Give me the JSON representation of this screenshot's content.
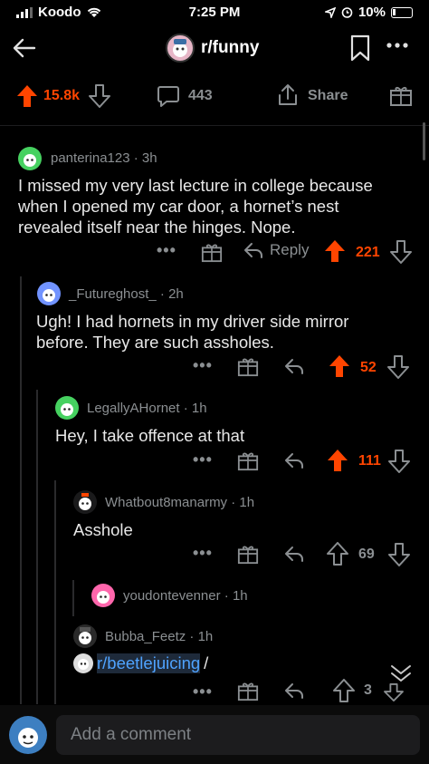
{
  "status_bar": {
    "carrier": "Koodo",
    "time": "7:25 PM",
    "battery": "10%"
  },
  "header": {
    "subreddit": "r/funny"
  },
  "post_actions": {
    "votes": "15.8k",
    "comments": "443",
    "share": "Share"
  },
  "comments": [
    {
      "author": "panterina123",
      "age": "3h",
      "text": "I missed my very last lecture in college because when I opened my car door, a hornet’s nest revealed itself near the hinges. Nope.",
      "reply_label": "Reply",
      "score": "221",
      "upvoted": true
    },
    {
      "author": "_Futureghost_",
      "age": "2h",
      "text": "Ugh! I had hornets in my driver side mirror before. They are such assholes.",
      "score": "52",
      "upvoted": true
    },
    {
      "author": "LegallyAHornet",
      "age": "1h",
      "text": "Hey, I take offence at that",
      "score": "111",
      "upvoted": true
    },
    {
      "author": "Whatbout8manarmy",
      "age": "1h",
      "text": "Asshole",
      "score": "69",
      "upvoted": false
    },
    {
      "author": "youdontevenner",
      "age": "1h"
    },
    {
      "author": "Bubba_Feetz",
      "age": "1h",
      "link": "r/beetlejuicing",
      "link_suffix": "/",
      "score": "3",
      "upvoted": false
    }
  ],
  "comment_bar": {
    "placeholder": "Add a comment"
  },
  "colors": {
    "accent": "#ff4500",
    "link": "#4fa3ff",
    "background": "#000000"
  }
}
